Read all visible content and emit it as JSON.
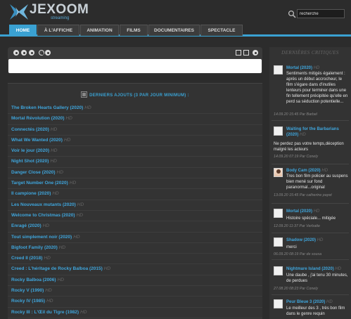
{
  "logo": {
    "name": "JEXOOM",
    "tagline": "streaming"
  },
  "search": {
    "value": "recherche"
  },
  "nav": {
    "tabs": [
      {
        "label": "HOME",
        "active": true
      },
      {
        "label": "À L'AFFICHE"
      },
      {
        "label": "ANIMATION"
      },
      {
        "label": "FILMS"
      },
      {
        "label": "DOCUMENTAIRES"
      },
      {
        "label": "SPECTACLE"
      }
    ]
  },
  "main": {
    "title": "DERNIERS AJOUTS (3 PAR JOUR MINIMUM) :",
    "movies": [
      {
        "title": "The Broken Hearts Gallery (2020)",
        "quality": "HD"
      },
      {
        "title": "Mortal Révolution (2020)",
        "quality": "HD"
      },
      {
        "title": "Connectés (2020)",
        "quality": "HD"
      },
      {
        "title": "What We Wanted (2020)",
        "quality": "HD"
      },
      {
        "title": "Voir le jour (2020)",
        "quality": "HD"
      },
      {
        "title": "Night Shot (2020)",
        "quality": "HD"
      },
      {
        "title": "Danger Close (2020)",
        "quality": "HD"
      },
      {
        "title": "Target Number One (2020)",
        "quality": "HD"
      },
      {
        "title": "Il campione (2020)",
        "quality": "HD"
      },
      {
        "title": "Les Nouveaux mutants (2020)",
        "quality": "HD"
      },
      {
        "title": "Welcome to Christmas (2020)",
        "quality": "HD"
      },
      {
        "title": "Enragé (2020)",
        "quality": "HD"
      },
      {
        "title": "Tout simplement noir (2020)",
        "quality": "HD"
      },
      {
        "title": "Bigfoot Family (2020)",
        "quality": "HD"
      },
      {
        "title": "Creed II (2018)",
        "quality": "HD"
      },
      {
        "title": "Creed : L'héritage de Rocky Balboa (2015)",
        "quality": "HD"
      },
      {
        "title": "Rocky Balboa (2006)",
        "quality": "HD"
      },
      {
        "title": "Rocky V (1990)",
        "quality": "HD"
      },
      {
        "title": "Rocky IV (1985)",
        "quality": "HD"
      },
      {
        "title": "Rocky III : L'Œil du Tigre (1982)",
        "quality": "HD"
      }
    ]
  },
  "sidebar": {
    "title": "DERNIÈRES CRITIQUES",
    "reviews": [
      {
        "movie": "Mortal (2020)",
        "quality": "HD",
        "text": "Sentiments mitigés également : après un début accrocheur, le film s'égare dans d'inutiles lenteurs pour terminer dans une fin tellement précipitée qu'elle en perd sa séduction potentielle...",
        "meta": "14.09.20 15:45 Par Barbel"
      },
      {
        "movie": "Waiting for the Barbarians (2020)",
        "quality": "HD",
        "text": "Ne perdez pas votre temps,déception malgré les acteurs",
        "meta": "14.09.20 07:19 Par Conely"
      },
      {
        "movie": "Body Cam (2020)",
        "quality": "HD",
        "text": "Tres bon film policier au suspens bien mené sur fond paranormal...original",
        "meta": "13.09.20 15:45 Par catherine payet"
      },
      {
        "movie": "Mortal (2020)",
        "quality": "HD",
        "text": "Histoire spéciale... mitigée",
        "meta": "12.09.20 11:37 Par Verbatte"
      },
      {
        "movie": "Shadow (2020)",
        "quality": "HD",
        "text": "merci",
        "meta": "06.09.20 08:19 Par de sousa"
      },
      {
        "movie": "Nightmare Island (2020)",
        "quality": "HD",
        "text": "Une daube , j'ai tenu 30 minutes, de perdues",
        "meta": "27.08.20 08:23 Par Conely"
      },
      {
        "movie": "Peur Bleue 3 (2020)",
        "quality": "HD",
        "text": "Le meilleur des 3 , très bon film dans le genre requin",
        "meta": ""
      }
    ]
  },
  "colors": {
    "accent": "#3aa1d2",
    "link": "#3fa6dd",
    "background": "#2c2c2c"
  }
}
